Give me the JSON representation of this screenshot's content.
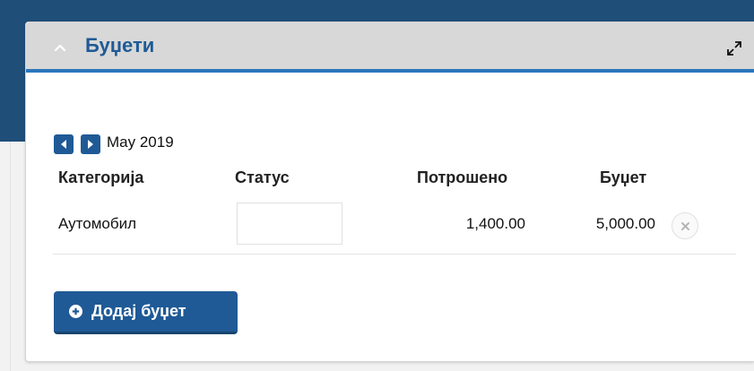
{
  "widget": {
    "title": "Буџети"
  },
  "period": {
    "label": "May 2019"
  },
  "table": {
    "headers": {
      "category": "Категорија",
      "status": "Статус",
      "spent": "Потрошено",
      "budget": "Буџет"
    },
    "rows": [
      {
        "category": "Аутомобил",
        "spent": "1,400.00",
        "budget": "5,000.00"
      }
    ]
  },
  "actions": {
    "add_label": "Додај буџет"
  },
  "colors": {
    "accent": "#1f5a96",
    "header_border": "#2b76bd",
    "header_bg": "#d8d8d8"
  },
  "icons": {
    "collapse": "chevron-up-icon",
    "expand": "expand-icon",
    "prev": "caret-left-icon",
    "next": "caret-right-icon",
    "remove": "close-circle-icon",
    "add": "plus-circle-icon"
  }
}
